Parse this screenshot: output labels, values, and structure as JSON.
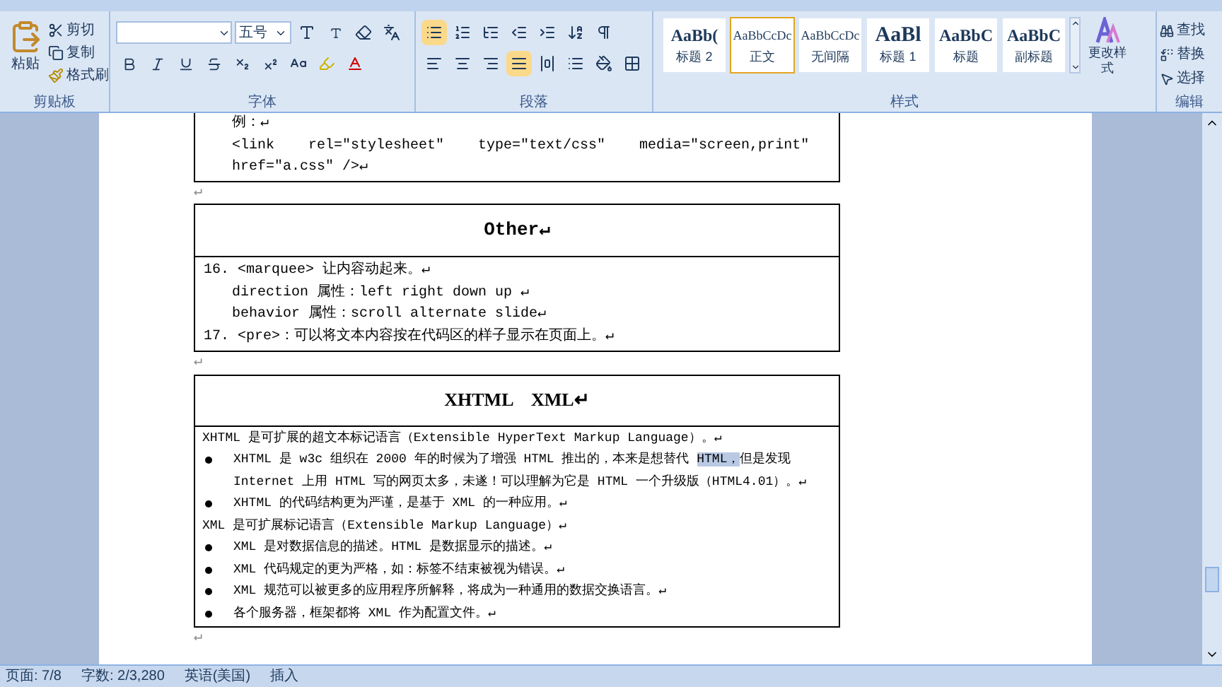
{
  "clipboard": {
    "paste": "粘贴",
    "cut": "剪切",
    "copy": "复制",
    "format_painter": "格式刷",
    "group": "剪贴板"
  },
  "font": {
    "font_size": "五号",
    "group": "字体"
  },
  "paragraph": {
    "group": "段落"
  },
  "styles": {
    "items": [
      {
        "sample": "AaBb(",
        "label": "标题 2",
        "selected": false
      },
      {
        "sample": "AaBbCcDc",
        "label": "正文",
        "selected": true
      },
      {
        "sample": "AaBbCcDc",
        "label": "无间隔",
        "selected": false
      },
      {
        "sample": "AaBl",
        "label": "标题 1",
        "selected": false
      },
      {
        "sample": "AaBbC",
        "label": "标题",
        "selected": false
      },
      {
        "sample": "AaBbC",
        "label": "副标题",
        "selected": false
      }
    ],
    "change_styles": "更改样式",
    "group": "样式"
  },
  "editing": {
    "find": "查找",
    "replace": "替换",
    "select": "选择",
    "group": "编辑"
  },
  "document": {
    "table_1_lines": [
      "例：↵",
      "<link rel=\"stylesheet\" type=\"text/css\" media=\"screen,print\"",
      "href=\"a.css\" />↵"
    ],
    "other_table": {
      "title": "Other↵",
      "lines": [
        {
          "text": "16. <marquee> 让内容动起来。↵",
          "indent": false
        },
        {
          "text": "direction 属性：left right down up ↵",
          "indent": true
        },
        {
          "text": "behavior 属性：scroll alternate slide↵",
          "indent": true
        },
        {
          "text": "17. <pre>：可以将文本内容按在代码区的样子显示在页面上。↵",
          "indent": false
        }
      ]
    },
    "xml_table": {
      "title": "XHTML    XML↵",
      "lines": [
        {
          "kind": "paragraph",
          "segments": [
            {
              "text": "XHTML 是可扩展的超文本标记语言（Extensible HyperText Markup Language）。↵",
              "selected": false
            }
          ]
        },
        {
          "kind": "bullet",
          "segments": [
            {
              "text": "XHTML 是 w3c 组织在 2000 年的时候为了增强 HTML 推出的，本来是想替代 ",
              "selected": false
            },
            {
              "text": "HTML，",
              "selected": true
            },
            {
              "text": "但是发现 Internet 上用 HTML 写的网页太多，未遂！可以理解为它是 HTML 一个升级版（HTML4.01）。↵",
              "selected": false
            }
          ]
        },
        {
          "kind": "bullet",
          "segments": [
            {
              "text": "XHTML 的代码结构更为严谨，是基于 XML 的一种应用。↵",
              "selected": false
            }
          ]
        },
        {
          "kind": "paragraph",
          "segments": [
            {
              "text": "XML 是可扩展标记语言（Extensible Markup Language）↵",
              "selected": false
            }
          ]
        },
        {
          "kind": "bullet",
          "segments": [
            {
              "text": "XML 是对数据信息的描述。HTML 是数据显示的描述。↵",
              "selected": false
            }
          ]
        },
        {
          "kind": "bullet",
          "segments": [
            {
              "text": "XML 代码规定的更为严格，如：标签不结束被视为错误。↵",
              "selected": false
            }
          ]
        },
        {
          "kind": "bullet",
          "segments": [
            {
              "text": "XML 规范可以被更多的应用程序所解释，将成为一种通用的数据交换语言。↵",
              "selected": false
            }
          ]
        },
        {
          "kind": "bullet",
          "segments": [
            {
              "text": "各个服务器，框架都将 XML 作为配置文件。↵",
              "selected": false
            }
          ]
        }
      ]
    },
    "empty_paragraph": "↵"
  },
  "status_bar": {
    "page": "页面: 7/8",
    "words": "字数: 2/3,280",
    "language": "英语(美国)",
    "mode": "插入"
  }
}
